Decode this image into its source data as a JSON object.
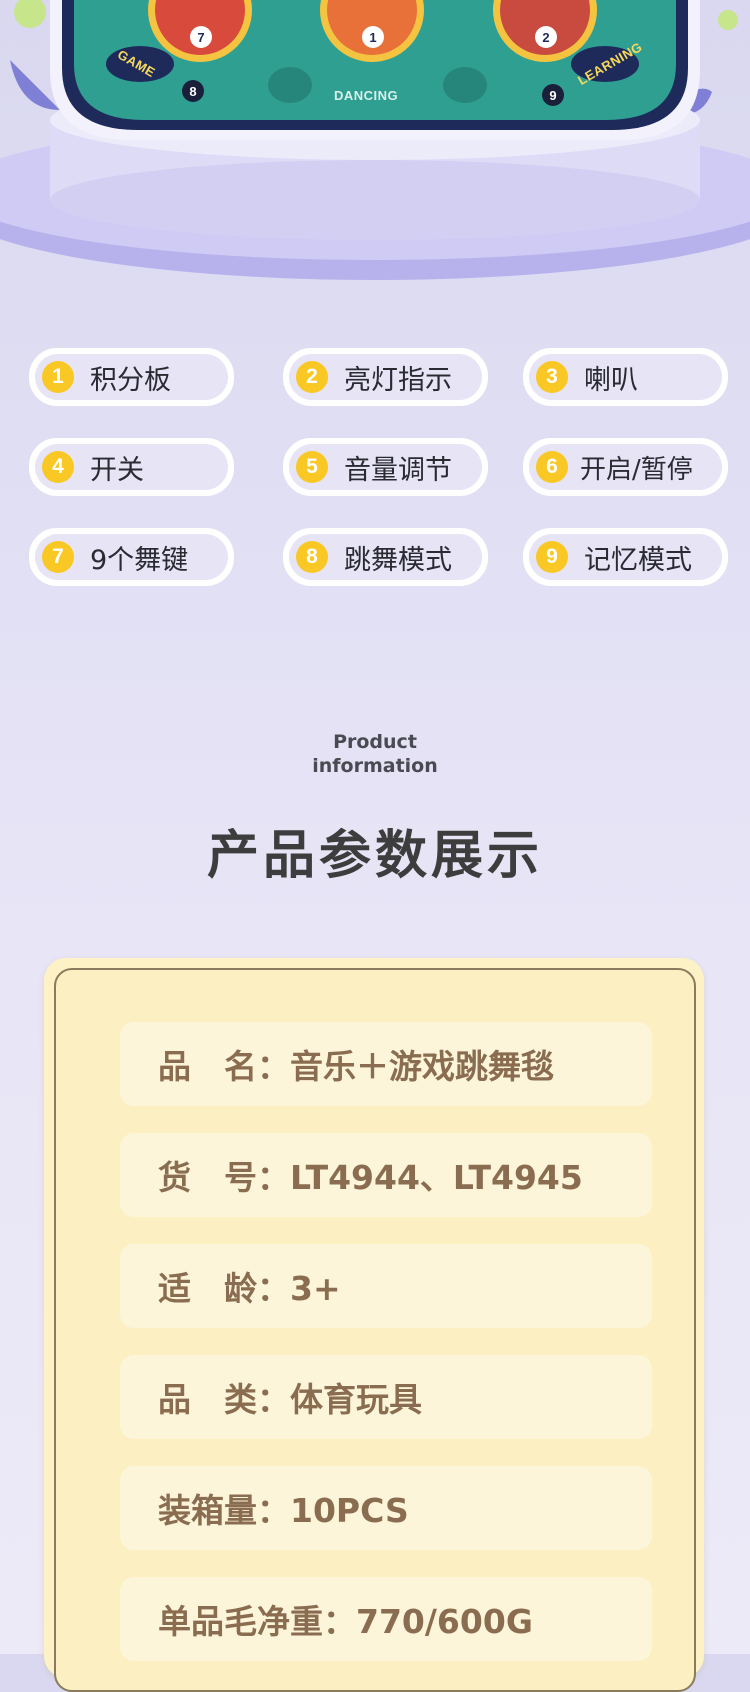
{
  "hero": {
    "labels": {
      "left": "GAME",
      "center": "DANCING",
      "right": "LEARNING"
    },
    "button_numbers": [
      "7",
      "1",
      "2"
    ],
    "bottom_numbers": [
      "8",
      "9"
    ]
  },
  "features": [
    {
      "num": "1",
      "label": "积分板"
    },
    {
      "num": "2",
      "label": "亮灯指示"
    },
    {
      "num": "3",
      "label": "喇叭"
    },
    {
      "num": "4",
      "label": "开关"
    },
    {
      "num": "5",
      "label": "音量调节"
    },
    {
      "num": "6",
      "label": "开启/暂停"
    },
    {
      "num": "7",
      "label": "9个舞键"
    },
    {
      "num": "8",
      "label": "跳舞模式"
    },
    {
      "num": "9",
      "label": "记忆模式"
    }
  ],
  "info": {
    "en_title_line1": "Product",
    "en_title_line2": "information",
    "cn_title": "产品参数展示",
    "rows": [
      "品　名：音乐＋游戏跳舞毯",
      "货　号：LT4944、LT4945",
      "适　龄：3+",
      "品　类：体育玩具",
      "装箱量：10PCS",
      "单品毛净重：770/600G"
    ]
  },
  "colors": {
    "badge": "#f9c825",
    "mat_green": "#2e9f91",
    "mat_navy": "#1e2a5a",
    "card_bg": "#fdf2c6",
    "row_text": "#8a6d50"
  }
}
